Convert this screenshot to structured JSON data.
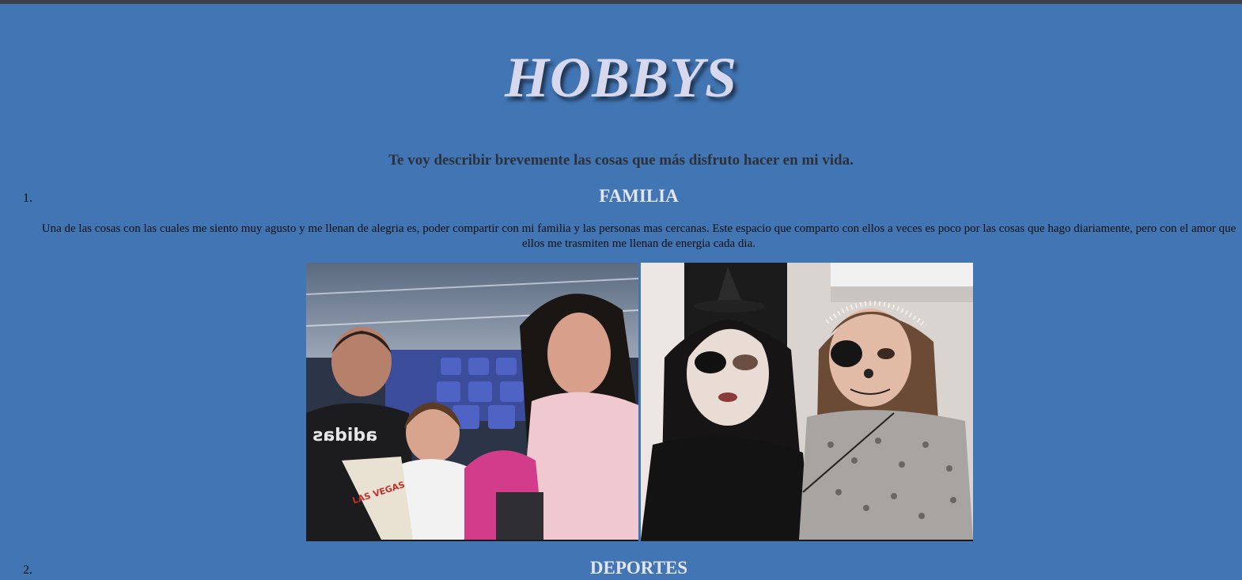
{
  "page": {
    "title": "HOBBYS",
    "intro": "Te voy describir brevemente las cosas que más disfruto hacer en mi vida."
  },
  "sections": [
    {
      "number": "1.",
      "heading": "FAMILIA",
      "text": "Una de las cosas con las cuales me siento muy agusto y me llenan de alegria es, poder compartir con mi familia y las personas mas cercanas. Este espacio que comparto con ellos a veces es poco por las cosas que hago diariamente, pero con el amor que ellos me trasmiten me llenan de energia cada dia.",
      "photos": [
        {
          "name": "family-stadium-photo",
          "shirt_text": "adidas",
          "cup_text": "LAS VEGAS"
        },
        {
          "name": "family-halloween-photo"
        }
      ]
    },
    {
      "number": "2.",
      "heading": "DEPORTES"
    }
  ],
  "colors": {
    "background": "#4275b3",
    "title": "#d7d8ee",
    "heading": "#e4e5f2",
    "intro": "#2c3139"
  }
}
